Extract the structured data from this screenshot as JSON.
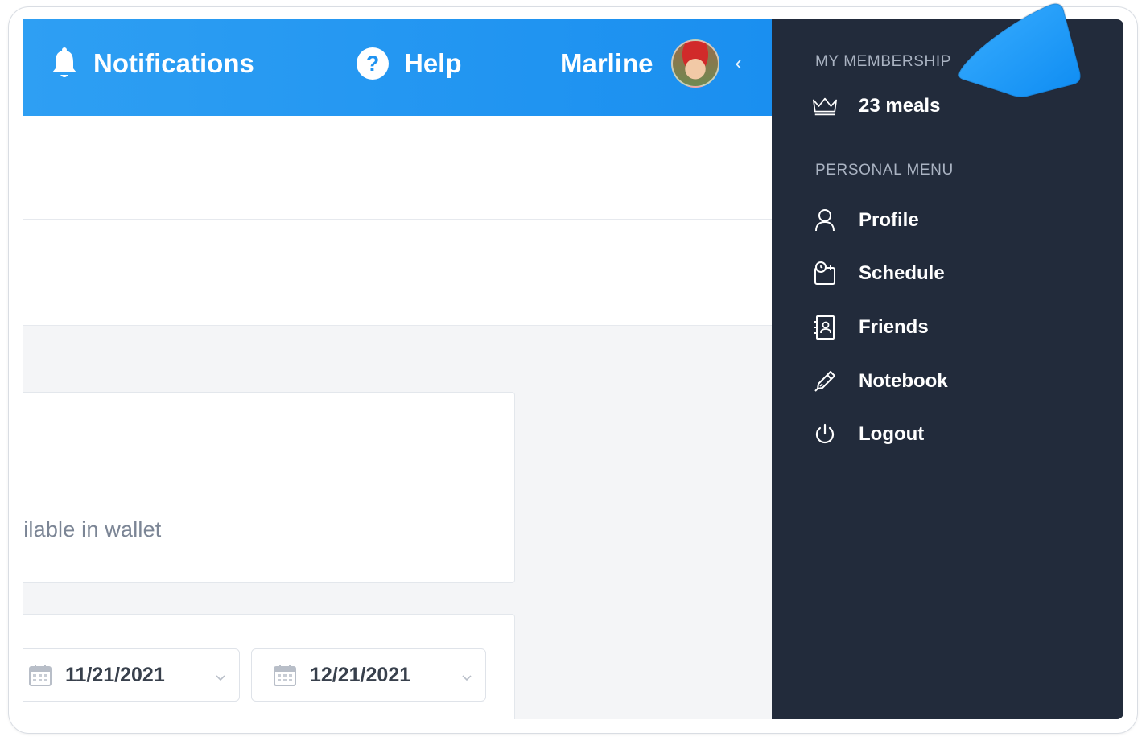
{
  "topbar": {
    "notifications_label": "Notifications",
    "help_label": "Help",
    "user_name": "Marline",
    "collapse_icon": "‹"
  },
  "main": {
    "wallet_text": "ailable in wallet",
    "date_start": "11/21/2021",
    "date_end": "12/21/2021"
  },
  "sidebar": {
    "membership_title": "MY MEMBERSHIP",
    "meals": "23 meals",
    "personal_title": "PERSONAL MENU",
    "items": [
      {
        "label": "Profile",
        "icon": "user-icon"
      },
      {
        "label": "Schedule",
        "icon": "schedule-icon"
      },
      {
        "label": "Friends",
        "icon": "contacts-icon"
      },
      {
        "label": "Notebook",
        "icon": "pen-icon"
      },
      {
        "label": "Logout",
        "icon": "power-icon"
      }
    ]
  },
  "colors": {
    "topbar": "#1f93f1",
    "sidebar": "#222b3b",
    "highlight": "#1e9cff"
  }
}
